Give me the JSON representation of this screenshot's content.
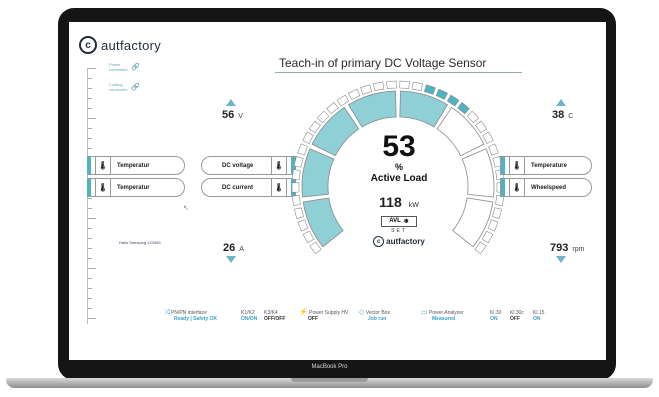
{
  "app": {
    "brand": "autfactory",
    "device_label": "MacBook Pro"
  },
  "header": {
    "title": "Teach-in of primary DC Voltage Sensor"
  },
  "connections": [
    {
      "label": "Power",
      "state": "connected"
    },
    {
      "label": "Cooling",
      "state": "connected"
    }
  ],
  "left_panel": {
    "voltage": {
      "value": "56",
      "unit": "V"
    },
    "current": {
      "value": "26",
      "unit": "A"
    },
    "pills": [
      "Temperatur",
      "Temperatur"
    ],
    "note": "Hallo Samsung 123455"
  },
  "center_pills": [
    "DC voltage",
    "DC current"
  ],
  "gauge": {
    "value": "53",
    "unit": "%",
    "label": "Active Load",
    "power_value": "118",
    "power_unit": "kW",
    "badge": "AVL",
    "badge_icon": "snowflake-icon",
    "set_label": "SET",
    "brand": "autfactory",
    "accent_color": "#8fcfd6",
    "level": 0.53
  },
  "right_panel": {
    "temperature": {
      "value": "38",
      "unit": "C"
    },
    "wheelspeed": {
      "value": "793",
      "unit": "rpm"
    },
    "pills": [
      "Temperature",
      "Wheelspeed"
    ]
  },
  "footer": [
    {
      "label": "PN/PN interface",
      "value": "Ready | Safety OK",
      "icon": "shuffle-icon"
    },
    {
      "label": "K1/K2",
      "value": "ON/ON"
    },
    {
      "label": "K3/K4",
      "value": "OFF/OFF"
    },
    {
      "label": "Power Supply HV",
      "value": "OFF",
      "icon": "bolt-icon"
    },
    {
      "label": "Vector Box",
      "value": "Job run",
      "icon": "vector-icon"
    },
    {
      "label": "Power Analyzer",
      "value": "Measured",
      "icon": "analyzer-icon"
    },
    {
      "label": "Kl.30",
      "value": "ON"
    },
    {
      "label": "Kl.30c",
      "value": "OFF"
    },
    {
      "label": "Kl.15",
      "value": "ON"
    }
  ]
}
